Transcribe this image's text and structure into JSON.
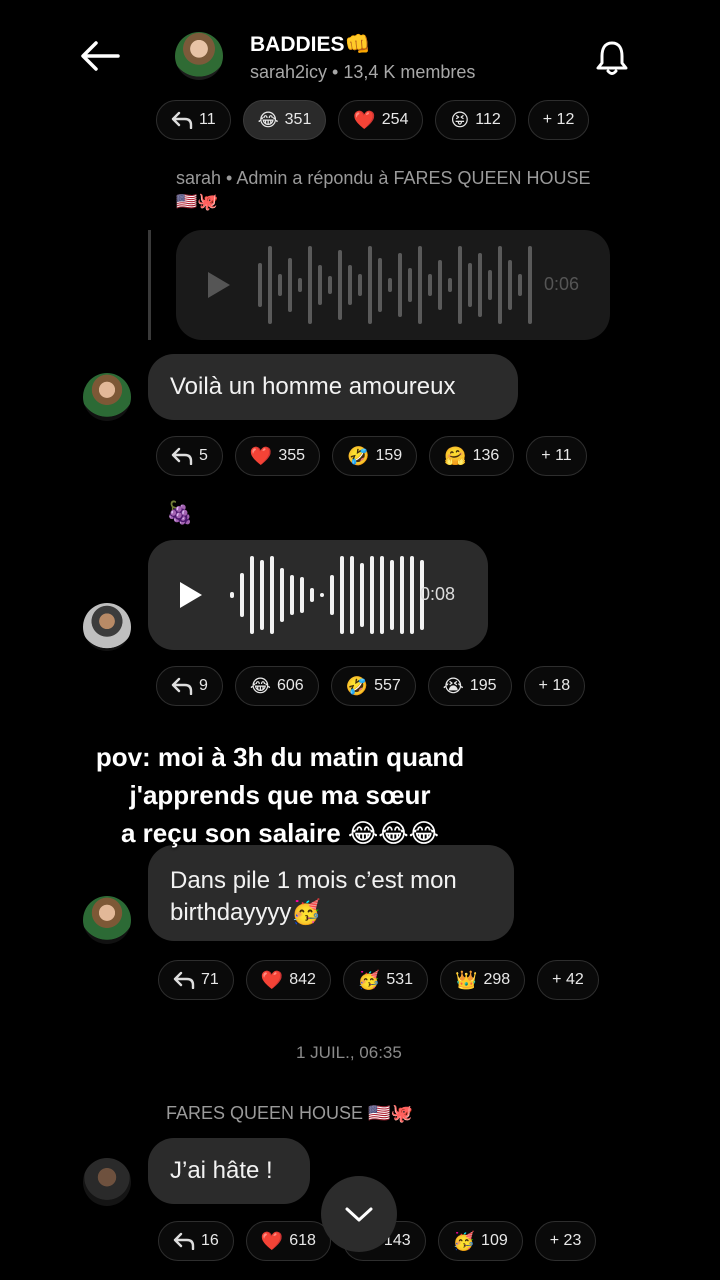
{
  "header": {
    "title": "BADDIES👊",
    "subtitle": "sarah2icy • 13,4 K membres"
  },
  "messages": [
    {
      "reactions": [
        {
          "icon": "reply-icon",
          "emoji": "",
          "count": "11"
        },
        {
          "icon": "laugh-emoji",
          "emoji": "😂",
          "count": "351"
        },
        {
          "icon": "heart-emoji",
          "emoji": "❤️",
          "count": "254"
        },
        {
          "icon": "tongue-emoji",
          "emoji": "😝",
          "count": "112"
        },
        {
          "icon": "",
          "emoji": "",
          "count": "+ 12"
        }
      ]
    },
    {
      "reply_meta": "sarah • Admin a répondu à FARES QUEEN HOUSE",
      "reply_flags": "🇺🇸🐙",
      "voice_duration": "0:06",
      "text": "Voilà un homme amoureux",
      "reactions": [
        {
          "icon": "reply-icon",
          "emoji": "",
          "count": "5"
        },
        {
          "icon": "heart-emoji",
          "emoji": "❤️",
          "count": "355"
        },
        {
          "icon": "rofl-emoji",
          "emoji": "🤣",
          "count": "159"
        },
        {
          "icon": "hug-emoji",
          "emoji": "🤗",
          "count": "136"
        },
        {
          "icon": "",
          "emoji": "",
          "count": "+ 11"
        }
      ]
    },
    {
      "sender_emoji": "🍇",
      "voice_duration": "0:08",
      "reactions": [
        {
          "icon": "reply-icon",
          "emoji": "",
          "count": "9"
        },
        {
          "icon": "laugh-emoji",
          "emoji": "😂",
          "count": "606"
        },
        {
          "icon": "rofl-emoji",
          "emoji": "🤣",
          "count": "557"
        },
        {
          "icon": "cry-emoji",
          "emoji": "😭",
          "count": "195"
        },
        {
          "icon": "",
          "emoji": "",
          "count": "+ 18"
        }
      ]
    },
    {
      "text_line1": "Dans pile 1 mois c’est mon",
      "text_line2": "birthdayyyy🥳",
      "reactions": [
        {
          "icon": "reply-icon",
          "emoji": "",
          "count": "71"
        },
        {
          "icon": "heart-emoji",
          "emoji": "❤️",
          "count": "842"
        },
        {
          "icon": "party-emoji",
          "emoji": "🥳",
          "count": "531"
        },
        {
          "icon": "crown-emoji",
          "emoji": "👑",
          "count": "298"
        },
        {
          "icon": "",
          "emoji": "",
          "count": "+ 42"
        }
      ]
    },
    {
      "date": "1 JUIL., 06:35",
      "sender": "FARES QUEEN HOUSE 🇺🇸🐙",
      "text": "J’ai hâte !",
      "reactions": [
        {
          "icon": "reply-icon",
          "emoji": "",
          "count": "16"
        },
        {
          "icon": "heart-emoji",
          "emoji": "❤️",
          "count": "618"
        },
        {
          "icon": "",
          "emoji": "",
          "count": "143"
        },
        {
          "icon": "party-emoji",
          "emoji": "🥳",
          "count": "109"
        },
        {
          "icon": "",
          "emoji": "",
          "count": "+ 23"
        }
      ]
    }
  ],
  "overlay": {
    "line1": "pov: moi à 3h du matin quand",
    "line2": "j'apprends que ma sœur",
    "line3": "a reçu son salaire 😂😂😂"
  },
  "voice_level_1": 0.0,
  "voice_level_2": 0.0
}
